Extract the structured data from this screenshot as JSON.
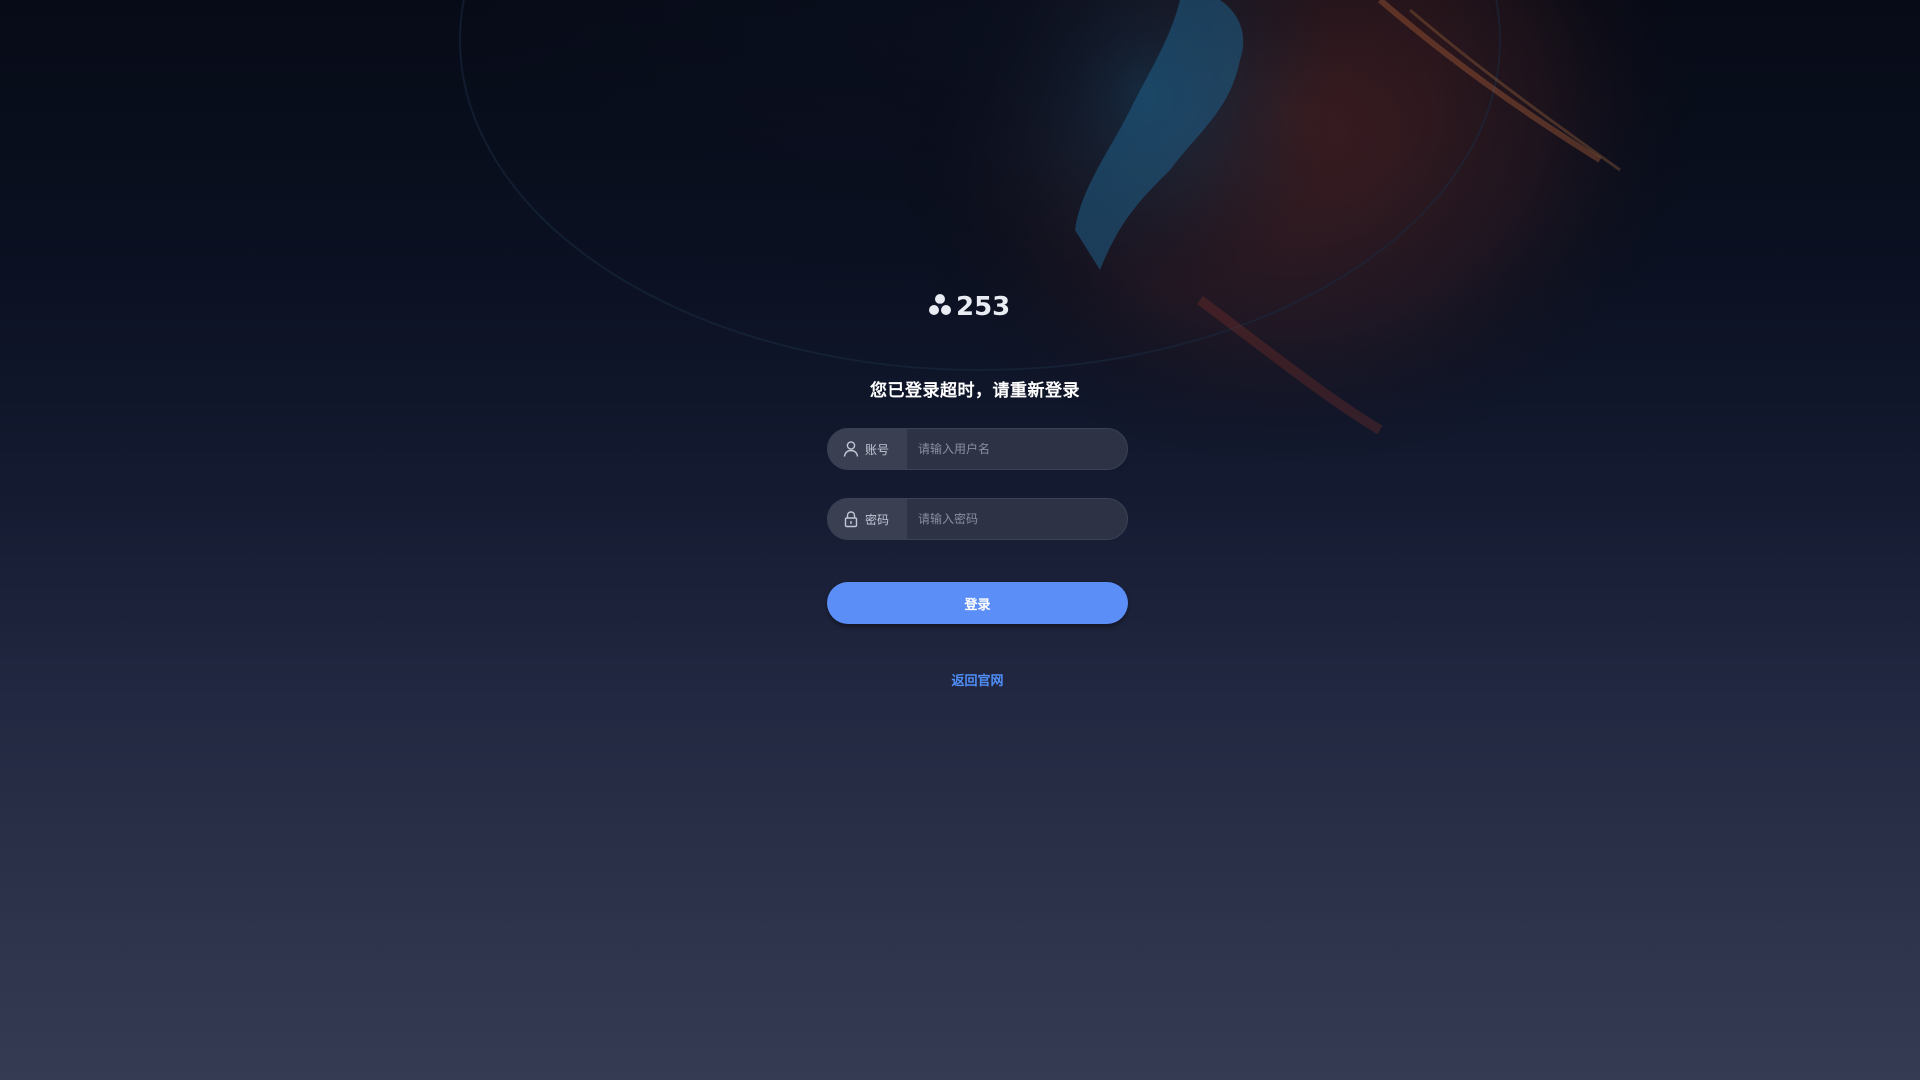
{
  "logo": {
    "text": "253",
    "icon": "trefoil-logo-icon"
  },
  "title": "您已登录超时，请重新登录",
  "form": {
    "username": {
      "label": "账号",
      "placeholder": "请输入用户名",
      "value": "",
      "icon": "user-icon"
    },
    "password": {
      "label": "密码",
      "placeholder": "请输入密码",
      "value": "",
      "icon": "lock-icon"
    },
    "login_label": "登录"
  },
  "back_link": "返回官网",
  "colors": {
    "accent": "#5b8ef6",
    "link": "#4f8ef7",
    "field_bg": "#2d3244",
    "label_bg": "#3a3f52"
  }
}
